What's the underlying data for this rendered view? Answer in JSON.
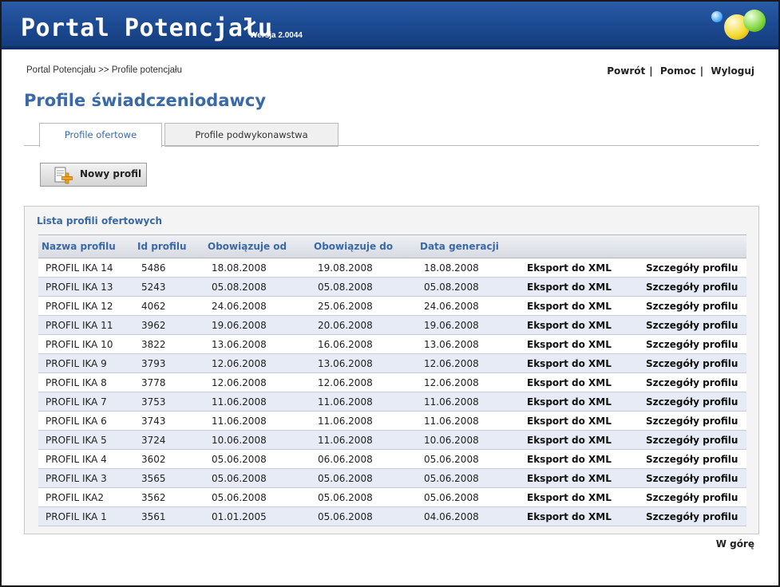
{
  "header": {
    "title": "Portal Potencjału",
    "version": "Wersja 2.0044"
  },
  "breadcrumb": "Portal Potencjału >> Profile potencjału",
  "toplinks": {
    "back": "Powrót",
    "help": "Pomoc",
    "logout": "Wyloguj",
    "separator": "|"
  },
  "page_title": "Profile świadczeniodawcy",
  "tabs": [
    {
      "label": "Profile ofertowe",
      "active": true
    },
    {
      "label": "Profile podwykonawstwa",
      "active": false
    }
  ],
  "new_profile_button": "Nowy profil",
  "list": {
    "title": "Lista profili ofertowych",
    "columns": [
      "Nazwa profilu",
      "Id profilu",
      "Obowiązuje od",
      "Obowiązuje do",
      "Data generacji",
      "",
      ""
    ],
    "rows": [
      {
        "name": "PROFIL IKA 14",
        "id": "5486",
        "from": "18.08.2008",
        "to": "19.08.2008",
        "generated": "18.08.2008",
        "export": "Eksport do XML",
        "details": "Szczegóły profilu"
      },
      {
        "name": "PROFIL IKA 13",
        "id": "5243",
        "from": "05.08.2008",
        "to": "05.08.2008",
        "generated": "05.08.2008",
        "export": "Eksport do XML",
        "details": "Szczegóły profilu"
      },
      {
        "name": "PROFIL IKA 12",
        "id": "4062",
        "from": "24.06.2008",
        "to": "25.06.2008",
        "generated": "24.06.2008",
        "export": "Eksport do XML",
        "details": "Szczegóły profilu"
      },
      {
        "name": "PROFIL IKA 11",
        "id": "3962",
        "from": "19.06.2008",
        "to": "20.06.2008",
        "generated": "19.06.2008",
        "export": "Eksport do XML",
        "details": "Szczegóły profilu"
      },
      {
        "name": "PROFIL IKA 10",
        "id": "3822",
        "from": "13.06.2008",
        "to": "16.06.2008",
        "generated": "13.06.2008",
        "export": "Eksport do XML",
        "details": "Szczegóły profilu"
      },
      {
        "name": "PROFIL IKA 9",
        "id": "3793",
        "from": "12.06.2008",
        "to": "13.06.2008",
        "generated": "12.06.2008",
        "export": "Eksport do XML",
        "details": "Szczegóły profilu"
      },
      {
        "name": "PROFIL IKA 8",
        "id": "3778",
        "from": "12.06.2008",
        "to": "12.06.2008",
        "generated": "12.06.2008",
        "export": "Eksport do XML",
        "details": "Szczegóły profilu"
      },
      {
        "name": "PROFIL IKA 7",
        "id": "3753",
        "from": "11.06.2008",
        "to": "11.06.2008",
        "generated": "11.06.2008",
        "export": "Eksport do XML",
        "details": "Szczegóły profilu"
      },
      {
        "name": "PROFIL IKA 6",
        "id": "3743",
        "from": "11.06.2008",
        "to": "11.06.2008",
        "generated": "11.06.2008",
        "export": "Eksport do XML",
        "details": "Szczegóły profilu"
      },
      {
        "name": "PROFIL IKA 5",
        "id": "3724",
        "from": "10.06.2008",
        "to": "11.06.2008",
        "generated": "10.06.2008",
        "export": "Eksport do XML",
        "details": "Szczegóły profilu"
      },
      {
        "name": "PROFIL IKA 4",
        "id": "3602",
        "from": "05.06.2008",
        "to": "06.06.2008",
        "generated": "05.06.2008",
        "export": "Eksport do XML",
        "details": "Szczegóły profilu"
      },
      {
        "name": "PROFIL IKA 3",
        "id": "3565",
        "from": "05.06.2008",
        "to": "05.06.2008",
        "generated": "05.06.2008",
        "export": "Eksport do XML",
        "details": "Szczegóły profilu"
      },
      {
        "name": "PROFIL IKA2",
        "id": "3562",
        "from": "05.06.2008",
        "to": "05.06.2008",
        "generated": "05.06.2008",
        "export": "Eksport do XML",
        "details": "Szczegóły profilu"
      },
      {
        "name": "PROFIL IKA 1",
        "id": "3561",
        "from": "01.01.2005",
        "to": "05.06.2008",
        "generated": "04.06.2008",
        "export": "Eksport do XML",
        "details": "Szczegóły profilu"
      }
    ]
  },
  "footer_link": "W górę",
  "icons": {
    "logo": "colored-balls-logo-icon",
    "new_profile": "document-add-icon"
  },
  "colors": {
    "header_blue": "#1d4b93",
    "accent": "#3a69a8",
    "row_alt": "#e6ebf6"
  }
}
